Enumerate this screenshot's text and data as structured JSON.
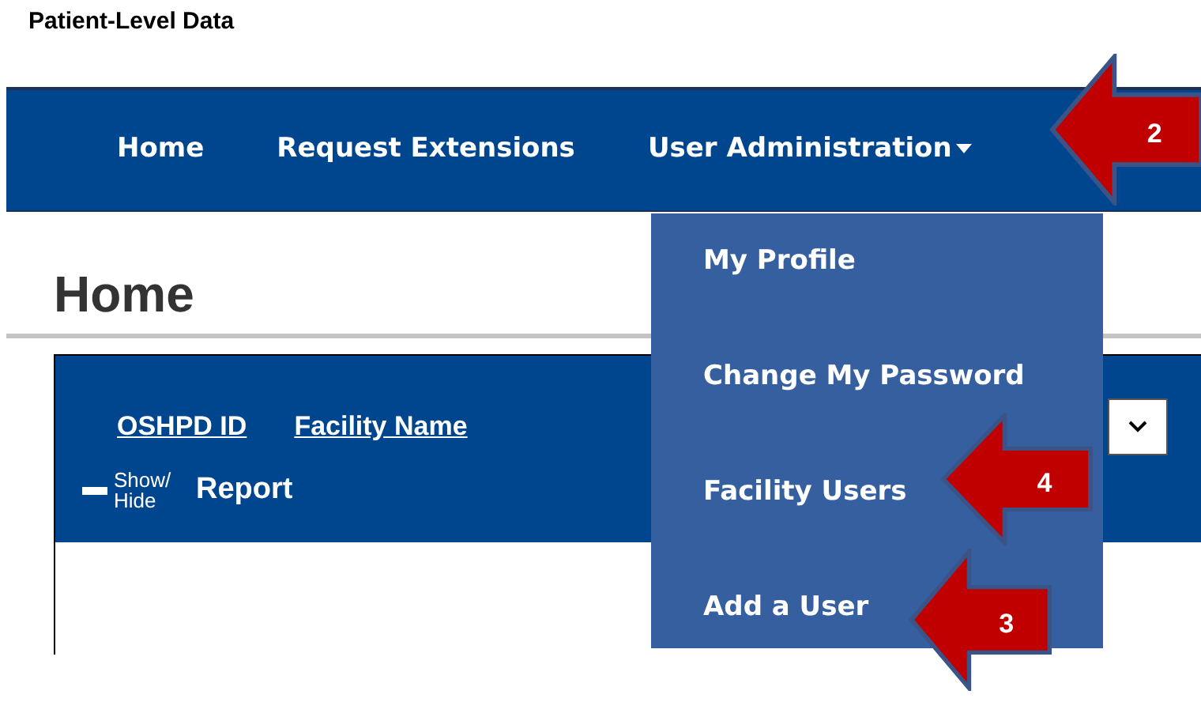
{
  "page_title": "Patient-Level Data",
  "nav": {
    "items": [
      {
        "label": "Home",
        "kind": "link"
      },
      {
        "label": "Request Extensions",
        "kind": "link"
      },
      {
        "label": "User Administration",
        "kind": "dropdown",
        "expanded": true
      }
    ]
  },
  "dropdown_menu": {
    "items": [
      "My Profile",
      "Change My Password",
      "Facility Users",
      "Add a User"
    ]
  },
  "heading": "Home",
  "panel": {
    "columns": [
      "OSHPD ID",
      "Facility Name"
    ],
    "show_hide": "Show/ Hide",
    "report_label": "Report"
  },
  "callouts": [
    {
      "number": "2"
    },
    {
      "number": "4"
    },
    {
      "number": "3"
    }
  ]
}
